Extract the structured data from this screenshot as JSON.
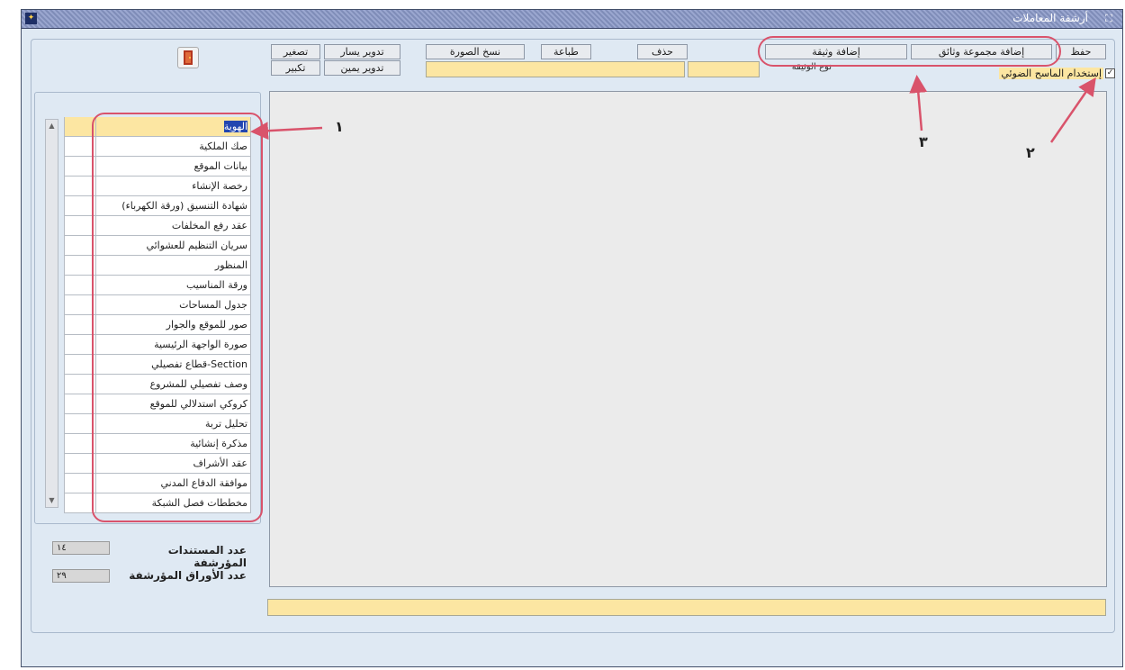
{
  "window": {
    "title": "أرشفة المعاملات"
  },
  "toolbar": {
    "save": "حفظ",
    "add_documents_group": "إضافة مجموعة وثائق",
    "add_document": "إضافة وثيقة",
    "delete": "حذف",
    "print": "طباعة",
    "copy_image": "نسخ الصورة",
    "rotate_left": "تدوير يسار",
    "rotate_right": "تدوير يمين",
    "zoom_out": "تصغير",
    "zoom_in": "تكبير"
  },
  "options": {
    "use_scanner_label": "إستخدام الماسح الضوئي",
    "use_scanner_checked": true,
    "doc_type_label": "نوع الوثيقة"
  },
  "annotations": {
    "one": "١",
    "two": "٢",
    "three": "٣"
  },
  "documents": [
    "الهوية",
    "صك الملكية",
    "بيانات الموقع",
    "رخصة الإنشاء",
    "شهادة التنسيق (ورقة الكهرباء)",
    "عقد رفع المخلفات",
    "سريان التنظيم للعشوائي",
    "المنظور",
    "ورقة المناسيب",
    "جدول المساحات",
    "صور للموقع والجوار",
    "صورة الواجهة الرئيسية",
    "قطاع تفصيلي-Section",
    "وصف تفصيلي للمشروع",
    "كروكي استدلالي للموقع",
    "تحليل تربة",
    "مذكرة إنشائية",
    "عقد الأشراف",
    "موافقة الدفاع المدني",
    "مخططات فصل الشبكة"
  ],
  "counts": {
    "archived_docs_label": "عدد المستندات المؤرشفة",
    "archived_docs_value": "١٤",
    "archived_pages_label": "عدد الأوراق المؤرشفة",
    "archived_pages_value": "٢٩"
  },
  "colors": {
    "field_yellow": "#fce6a2",
    "annotation_red": "#d9536b",
    "selection_blue": "#2246b0"
  }
}
